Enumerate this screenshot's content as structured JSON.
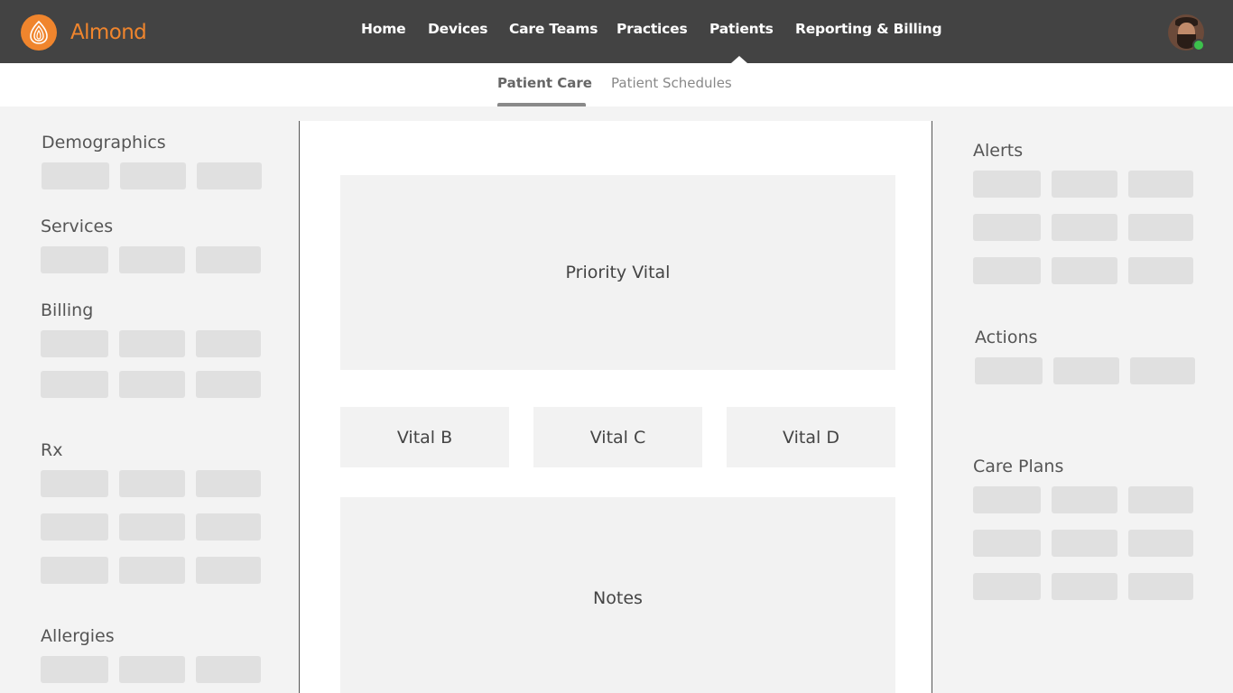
{
  "app": {
    "brand": "Almond",
    "brand_color": "#f0852d",
    "header_bg": "#434343"
  },
  "nav": {
    "items": [
      "Home",
      "Devices",
      "Care Teams",
      "Practices",
      "Patients",
      "Reporting & Billing"
    ],
    "active": "Patients"
  },
  "user": {
    "status": "online",
    "status_color": "#3cc04c"
  },
  "subnav": {
    "tabs": [
      "Patient Care",
      "Patient Schedules"
    ],
    "active": "Patient Care"
  },
  "left_sidebar": {
    "demographics": "Demographics",
    "services": "Services",
    "billing": "Billing",
    "rx": "Rx",
    "allergies": "Allergies"
  },
  "right_sidebar": {
    "alerts": "Alerts",
    "actions": "Actions",
    "care_plans": "Care Plans"
  },
  "main": {
    "priority_vital": "Priority Vital",
    "vital_b": "Vital B",
    "vital_c": "Vital C",
    "vital_d": "Vital D",
    "notes": "Notes"
  }
}
